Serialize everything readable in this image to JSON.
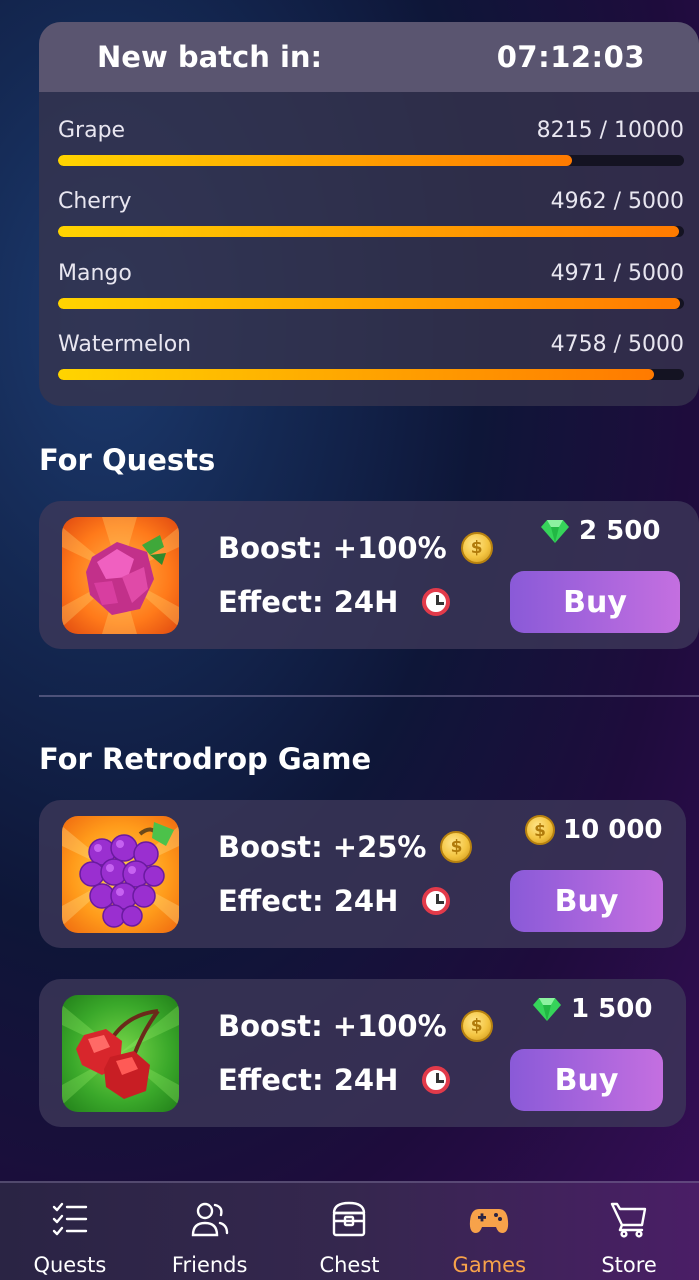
{
  "batch": {
    "title": "New batch in:",
    "timer": "07:12:03",
    "fruits": [
      {
        "name": "Grape",
        "count": "8215 / 10000",
        "progress": 0.8215
      },
      {
        "name": "Cherry",
        "count": "4962 / 5000",
        "progress": 0.9924
      },
      {
        "name": "Mango",
        "count": "4971 / 5000",
        "progress": 0.9942
      },
      {
        "name": "Watermelon",
        "count": "4758 / 5000",
        "progress": 0.9516
      }
    ]
  },
  "quests": {
    "title": "For Quests",
    "offers": [
      {
        "image": "raspberry-icon",
        "boost": "Boost: +100%",
        "effect": "Effect: 24H",
        "currency": "gem-icon",
        "price": "2 500",
        "buy_label": "Buy"
      }
    ]
  },
  "retrodrop": {
    "title": "For Retrodrop Game",
    "offers": [
      {
        "image": "grape-icon",
        "boost": "Boost: +25%",
        "effect": "Effect: 24H",
        "currency": "coin-icon",
        "price": "10 000",
        "buy_label": "Buy"
      },
      {
        "image": "cherry-icon",
        "boost": "Boost: +100%",
        "effect": "Effect: 24H",
        "currency": "gem-icon",
        "price": "1 500",
        "buy_label": "Buy"
      }
    ]
  },
  "nav": {
    "items": [
      {
        "label": "Quests",
        "icon": "checklist-icon"
      },
      {
        "label": "Friends",
        "icon": "friends-icon"
      },
      {
        "label": "Chest",
        "icon": "chest-icon"
      },
      {
        "label": "Games",
        "icon": "gamepad-icon",
        "active": true
      },
      {
        "label": "Store",
        "icon": "cart-icon"
      }
    ]
  },
  "colors": {
    "accent": "#f7a24a",
    "buy_button_start": "#8a5ad8",
    "buy_button_end": "#c46fe0",
    "progress_start": "#ffd400",
    "progress_end": "#ff7a00"
  }
}
